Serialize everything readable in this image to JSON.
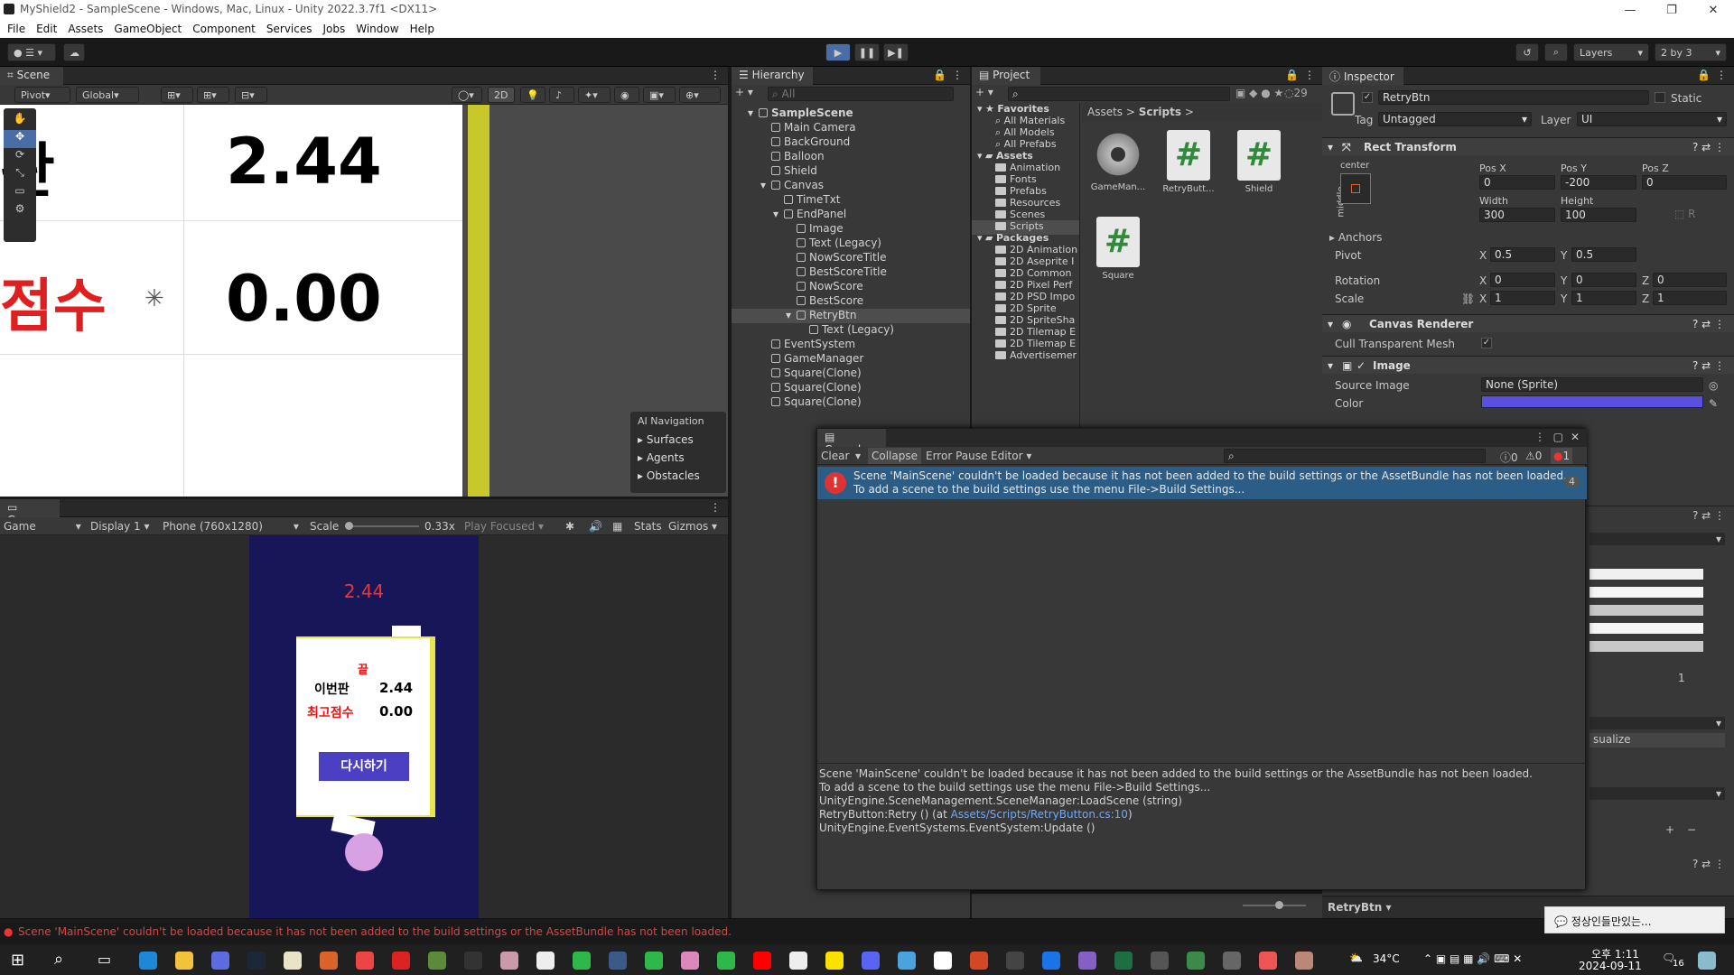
{
  "window": {
    "title": "MyShield2 - SampleScene - Windows, Mac, Linux - Unity 2022.3.7f1 <DX11>",
    "min": "—",
    "max": "❐",
    "close": "✕"
  },
  "menu": [
    "File",
    "Edit",
    "Assets",
    "GameObject",
    "Component",
    "Services",
    "Jobs",
    "Window",
    "Help"
  ],
  "toolbar": {
    "layers": "Layers",
    "layout": "2 by 3"
  },
  "scene": {
    "tab": "Scene",
    "pivot": "Pivot",
    "global": "Global",
    "mode2d": "2D",
    "text1": "판",
    "value1": "2.44",
    "text2": "점수",
    "value2": "0.00",
    "ai_title": "AI Navigation",
    "ai_items": [
      "Surfaces",
      "Agents",
      "Obstacles"
    ]
  },
  "game": {
    "tab": "Game",
    "mode": "Game",
    "display": "Display 1",
    "resolution": "Phone (760x1280)",
    "scale_label": "Scale",
    "scale_value": "0.33x",
    "play": "Play Focused",
    "stats": "Stats",
    "gizmos": "Gizmos",
    "score_top": "2.44",
    "end": "끝",
    "now_label": "이번판",
    "now_value": "2.44",
    "best_label": "최고점수",
    "best_value": "0.00",
    "retry": "다시하기"
  },
  "hierarchy": {
    "tab": "Hierarchy",
    "search": "All",
    "items": [
      {
        "label": "SampleScene",
        "depth": 0
      },
      {
        "label": "Main Camera",
        "depth": 1
      },
      {
        "label": "BackGround",
        "depth": 1
      },
      {
        "label": "Balloon",
        "depth": 1
      },
      {
        "label": "Shield",
        "depth": 1
      },
      {
        "label": "Canvas",
        "depth": 1
      },
      {
        "label": "TimeTxt",
        "depth": 2
      },
      {
        "label": "EndPanel",
        "depth": 2
      },
      {
        "label": "Image",
        "depth": 3
      },
      {
        "label": "Text (Legacy)",
        "depth": 3
      },
      {
        "label": "NowScoreTitle",
        "depth": 3
      },
      {
        "label": "BestScoreTitle",
        "depth": 3
      },
      {
        "label": "NowScore",
        "depth": 3
      },
      {
        "label": "BestScore",
        "depth": 3
      },
      {
        "label": "RetryBtn",
        "depth": 3
      },
      {
        "label": "Text (Legacy)",
        "depth": 4
      },
      {
        "label": "EventSystem",
        "depth": 1
      },
      {
        "label": "GameManager",
        "depth": 1
      },
      {
        "label": "Square(Clone)",
        "depth": 1
      },
      {
        "label": "Square(Clone)",
        "depth": 1
      },
      {
        "label": "Square(Clone)",
        "depth": 1
      }
    ]
  },
  "project": {
    "tab": "Project",
    "count": "29",
    "tree": [
      {
        "label": "Favorites",
        "depth": 0,
        "bold": true
      },
      {
        "label": "All Materials",
        "depth": 1
      },
      {
        "label": "All Models",
        "depth": 1
      },
      {
        "label": "All Prefabs",
        "depth": 1
      },
      {
        "label": "Assets",
        "depth": 0,
        "bold": true
      },
      {
        "label": "Animation",
        "depth": 1
      },
      {
        "label": "Fonts",
        "depth": 1
      },
      {
        "label": "Prefabs",
        "depth": 1
      },
      {
        "label": "Resources",
        "depth": 1
      },
      {
        "label": "Scenes",
        "depth": 1
      },
      {
        "label": "Scripts",
        "depth": 1
      },
      {
        "label": "Packages",
        "depth": 0,
        "bold": true
      },
      {
        "label": "2D Animation",
        "depth": 1
      },
      {
        "label": "2D Aseprite I",
        "depth": 1
      },
      {
        "label": "2D Common",
        "depth": 1
      },
      {
        "label": "2D Pixel Perf",
        "depth": 1
      },
      {
        "label": "2D PSD Impo",
        "depth": 1
      },
      {
        "label": "2D Sprite",
        "depth": 1
      },
      {
        "label": "2D SpriteSha",
        "depth": 1
      },
      {
        "label": "2D Tilemap E",
        "depth": 1
      },
      {
        "label": "2D Tilemap E",
        "depth": 1
      },
      {
        "label": "Advertisemer",
        "depth": 1
      }
    ],
    "breadcrumb": [
      "Assets",
      "Scripts"
    ],
    "files": [
      "GameMan...",
      "RetryButt...",
      "Shield",
      "Square"
    ]
  },
  "console": {
    "tab": "Console",
    "clear": "Clear",
    "collapse": "Collapse",
    "errorpause": "Error Pause",
    "editor": "Editor",
    "count_log": "0",
    "count_warn": "0",
    "count_err": "1",
    "msg1": "Scene 'MainScene' couldn't be loaded because it has not been added to the build settings or the AssetBundle has not been loaded.",
    "msg2": "To add a scene to the build settings use the menu File->Build Settings...",
    "badge": "4",
    "detail": [
      "Scene 'MainScene' couldn't be loaded because it has not been added to the build settings or the AssetBundle has not been loaded.",
      "To add a scene to the build settings use the menu File->Build Settings...",
      "UnityEngine.SceneManagement.SceneManager:LoadScene (string)",
      "UnityEngine.EventSystems.EventSystem:Update ()"
    ],
    "retry_prefix": "RetryButton:Retry () (at ",
    "retry_link": "Assets/Scripts/RetryButton.cs:10",
    "retry_suffix": ")"
  },
  "inspector": {
    "tab": "Inspector",
    "name": "RetryBtn",
    "static": "Static",
    "tag_label": "Tag",
    "tag": "Untagged",
    "layer_label": "Layer",
    "layer": "UI",
    "rect": "Rect Transform",
    "anchor_h": "center",
    "anchor_v": "middle",
    "posx_l": "Pos X",
    "posy_l": "Pos Y",
    "posz_l": "Pos Z",
    "posx": "0",
    "posy": "-200",
    "posz": "0",
    "width_l": "Width",
    "height_l": "Height",
    "width": "300",
    "height": "100",
    "anchors": "Anchors",
    "pivot": "Pivot",
    "pivot_x": "0.5",
    "pivot_y": "0.5",
    "rotation": "Rotation",
    "rot_x": "0",
    "rot_y": "0",
    "rot_z": "0",
    "scale": "Scale",
    "sc_x": "1",
    "sc_y": "1",
    "sc_z": "1",
    "canvas_renderer": "Canvas Renderer",
    "cull": "Cull Transparent Mesh",
    "image": "Image",
    "source_image": "Source Image",
    "source_value": "None (Sprite)",
    "color": "Color",
    "color_hex": "#5b4fe0",
    "slider_value": "1",
    "visualize": "sualize",
    "plus": "+",
    "minus": "−",
    "footer": "RetryBtn"
  },
  "statusbar": {
    "error": "Scene 'MainScene' couldn't be loaded because it has not been added to the build settings or the AssetBundle has not been loaded."
  },
  "taskbar": {
    "temp": "34°C",
    "time": "오후 1:11",
    "date": "2024-09-11",
    "notif": "정상인들만있는...",
    "badge": "16"
  }
}
